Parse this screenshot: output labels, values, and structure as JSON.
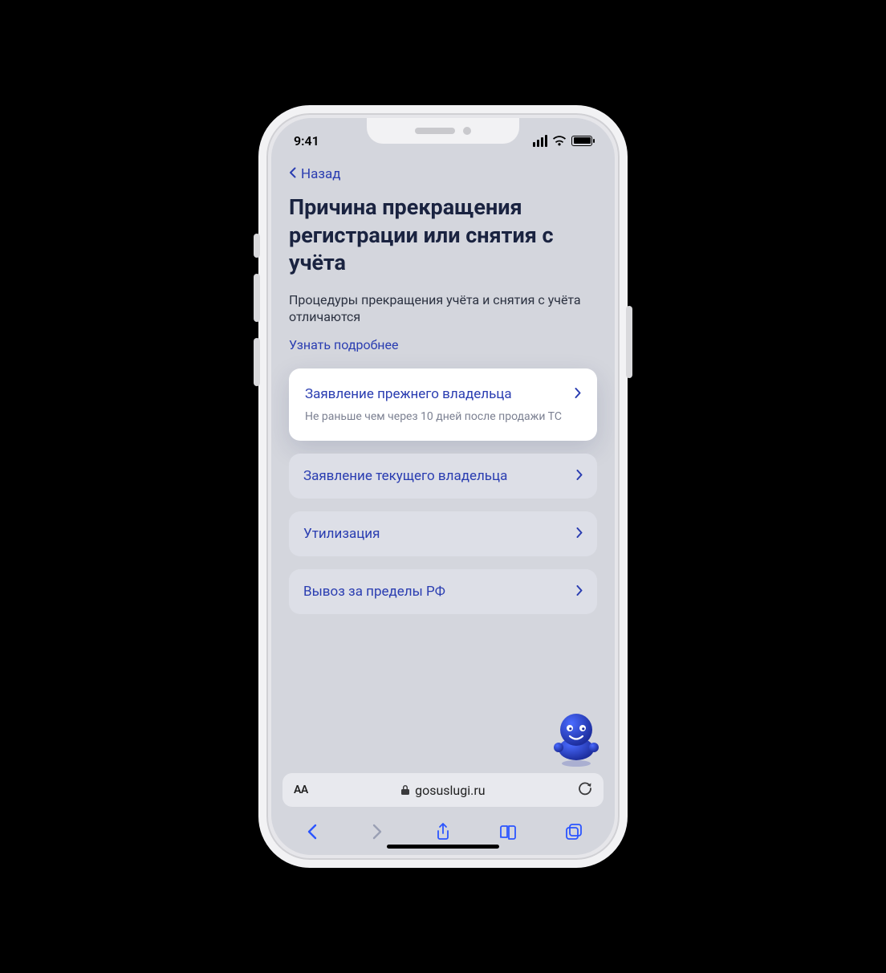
{
  "status": {
    "time": "9:41"
  },
  "nav": {
    "back": "Назад"
  },
  "page": {
    "title": "Причина прекращения регистрации или снятия с учёта",
    "subtitle": "Процедуры прекращения учёта и снятия с учёта отличаются",
    "learn_more": "Узнать подробнее"
  },
  "options": [
    {
      "label": "Заявление прежнего владельца",
      "sub": "Не раньше чем через 10 дней после продажи ТС",
      "highlighted": true
    },
    {
      "label": "Заявление текущего владельца"
    },
    {
      "label": "Утилизация"
    },
    {
      "label": "Вывоз за пределы РФ"
    }
  ],
  "browser": {
    "url": "gosuslugi.ru",
    "aa": "AA"
  }
}
